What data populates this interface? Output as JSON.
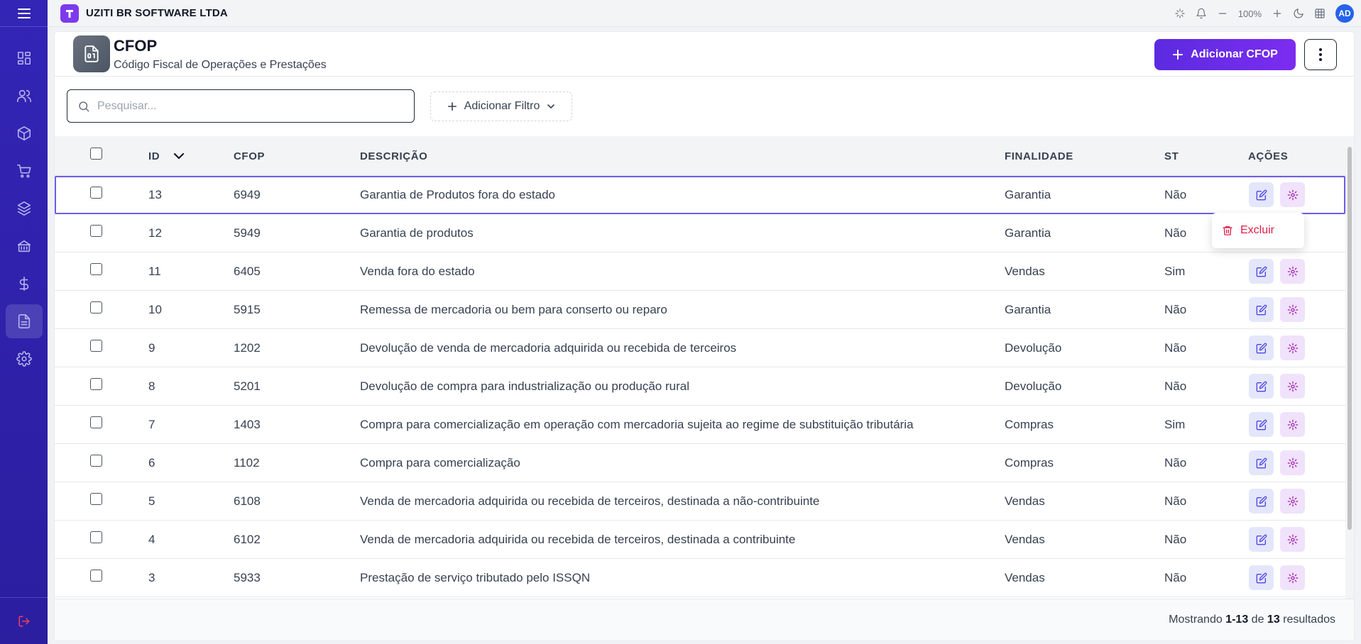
{
  "app": {
    "company": "UZITI BR SOFTWARE LTDA",
    "zoom": "100%",
    "avatar": "AD",
    "accent": "#5b2be0",
    "sidebar_color": "#3325b6"
  },
  "sidebar": {
    "items": [
      {
        "icon": "dashboard-icon"
      },
      {
        "icon": "users-icon"
      },
      {
        "icon": "box-icon"
      },
      {
        "icon": "cart-icon"
      },
      {
        "icon": "layers-icon"
      },
      {
        "icon": "bank-icon"
      },
      {
        "icon": "dollar-icon"
      },
      {
        "icon": "document-icon",
        "active": true
      },
      {
        "icon": "gear-icon"
      }
    ],
    "logout_icon": "logout-icon"
  },
  "header": {
    "title": "CFOP",
    "subtitle": "Código Fiscal de Operações e Prestações",
    "add_label": "Adicionar CFOP"
  },
  "filters": {
    "search_placeholder": "Pesquisar...",
    "add_filter_label": "Adicionar Filtro"
  },
  "table": {
    "columns": {
      "id": "ID",
      "cfop": "CFOP",
      "descricao": "DESCRIÇÃO",
      "finalidade": "FINALIDADE",
      "st": "ST",
      "acoes": "AÇÕES"
    },
    "rows": [
      {
        "id": "13",
        "cfop": "6949",
        "descricao": "Garantia de Produtos fora do estado",
        "finalidade": "Garantia",
        "st": "Não"
      },
      {
        "id": "12",
        "cfop": "5949",
        "descricao": "Garantia de produtos",
        "finalidade": "Garantia",
        "st": "Não"
      },
      {
        "id": "11",
        "cfop": "6405",
        "descricao": "Venda fora do estado",
        "finalidade": "Vendas",
        "st": "Sim"
      },
      {
        "id": "10",
        "cfop": "5915",
        "descricao": "Remessa de mercadoria ou bem para conserto ou reparo",
        "finalidade": "Garantia",
        "st": "Não"
      },
      {
        "id": "9",
        "cfop": "1202",
        "descricao": "Devolução de venda de mercadoria adquirida ou recebida de terceiros",
        "finalidade": "Devolução",
        "st": "Não"
      },
      {
        "id": "8",
        "cfop": "5201",
        "descricao": "Devolução de compra para industrialização ou produção rural",
        "finalidade": "Devolução",
        "st": "Não"
      },
      {
        "id": "7",
        "cfop": "1403",
        "descricao": "Compra para comercialização em operação com mercadoria sujeita ao regime de substituição tributária",
        "finalidade": "Compras",
        "st": "Sim"
      },
      {
        "id": "6",
        "cfop": "1102",
        "descricao": "Compra para comercialização",
        "finalidade": "Compras",
        "st": "Não"
      },
      {
        "id": "5",
        "cfop": "6108",
        "descricao": "Venda de mercadoria adquirida ou recebida de terceiros, destinada a não-contribuinte",
        "finalidade": "Vendas",
        "st": "Não"
      },
      {
        "id": "4",
        "cfop": "6102",
        "descricao": "Venda de mercadoria adquirida ou recebida de terceiros, destinada a contribuinte",
        "finalidade": "Vendas",
        "st": "Não"
      },
      {
        "id": "3",
        "cfop": "5933",
        "descricao": "Prestação de serviço tributado pelo ISSQN",
        "finalidade": "Vendas",
        "st": "Não"
      }
    ],
    "selected_row": 0
  },
  "dropdown": {
    "delete_label": "Excluir"
  },
  "footer": {
    "prefix": "Mostrando",
    "range": "1-13",
    "of": "de",
    "total": "13",
    "suffix": "resultados"
  }
}
